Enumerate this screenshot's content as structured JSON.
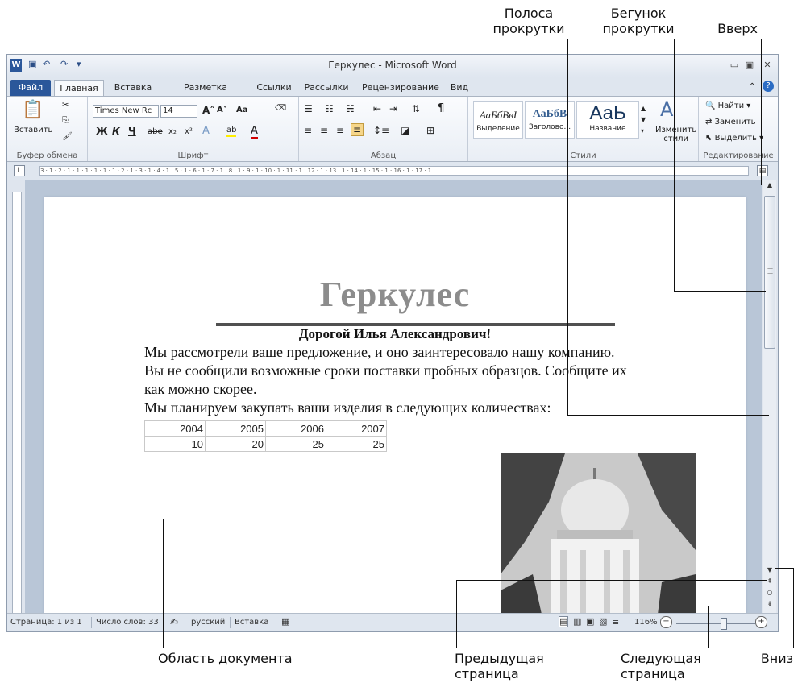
{
  "callouts": {
    "scrollbar": [
      "Полоса",
      "прокрутки"
    ],
    "thumb": [
      "Бегунок",
      "прокрутки"
    ],
    "up": "Вверх",
    "doc_area": "Область документа",
    "prev_page": [
      "Предыдущая",
      "страница"
    ],
    "next_page": [
      "Следующая",
      "страница"
    ],
    "down": "Вниз"
  },
  "window": {
    "title": "Геркулес - Microsoft Word"
  },
  "tabs": [
    "Файл",
    "Главная",
    "Вставка",
    "Разметка страницы",
    "Ссылки",
    "Рассылки",
    "Рецензирование",
    "Вид"
  ],
  "ribbon": {
    "clipboard": {
      "paste": "Вставить",
      "label": "Буфер обмена"
    },
    "font": {
      "name": "Times New Rc",
      "size": "14",
      "change_case": "Aa",
      "label": "Шрифт"
    },
    "paragraph": {
      "label": "Абзац"
    },
    "styles": {
      "items": [
        {
          "sample": "АаБбВвI",
          "name": "Выделение"
        },
        {
          "sample": "АаБбВ",
          "name": "Заголово..."
        },
        {
          "sample": "АаЬ",
          "name": "Название"
        }
      ],
      "change_line1": "Изменить",
      "change_line2": "стили",
      "label": "Стили"
    },
    "editing": {
      "find": "Найти",
      "replace": "Заменить",
      "select": "Выделить",
      "label": "Редактирование"
    }
  },
  "ruler": {
    "marks": "3 · 1 · 2 · 1 · 1 · 1 · 1 · 1 · 1 · 2 · 1 · 3 · 1 · 4 · 1 · 5 · 1 · 6 · 1 · 7 · 1 · 8 · 1 · 9 · 1 · 10 · 1 · 11 · 1 · 12 · 1 · 13 · 1 · 14 · 1 · 15 · 1 · 16 · 1 · 17 · 1"
  },
  "document": {
    "heading": "Геркулес",
    "salutation": "Дорогой Илья Александрович!",
    "paragraphs": [
      "Мы рассмотрели ваше предложение, и оно заинтересовало нашу компанию.",
      "Вы не сообщили возможные сроки поставки пробных образцов. Сообщите их",
      "как можно скорее.",
      "Мы планируем закупать ваши изделия в следующих количествах:"
    ],
    "table": {
      "years": [
        "2004",
        "2005",
        "2006",
        "2007"
      ],
      "quantities": [
        "10",
        "20",
        "25",
        "25"
      ]
    }
  },
  "status": {
    "page": "Страница: 1 из 1",
    "words": "Число слов: 33",
    "language": "русский",
    "mode": "Вставка",
    "zoom": "116%",
    "zoom_level": 0.6
  }
}
